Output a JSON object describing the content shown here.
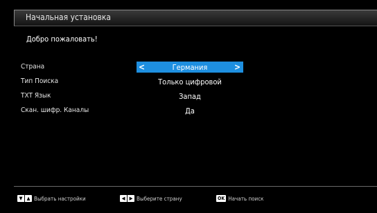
{
  "header": {
    "title": "Начальная установка"
  },
  "welcome": "Добро пожаловать!",
  "settings": [
    {
      "label": "Страна",
      "value": "Германия",
      "selected": true
    },
    {
      "label": "Тип Поиска",
      "value": "Только цифровой",
      "selected": false
    },
    {
      "label": "TXT Язык",
      "value": "Запад",
      "selected": false
    },
    {
      "label": "Скан. шифр. Каналы",
      "value": "Да",
      "selected": false
    }
  ],
  "selection_color": "#1e8fe0",
  "footer": {
    "hint_select": "Выбрать настройки",
    "hint_country": "Выберите страну",
    "hint_ok_key": "OK",
    "hint_start": "Начать поиск"
  }
}
